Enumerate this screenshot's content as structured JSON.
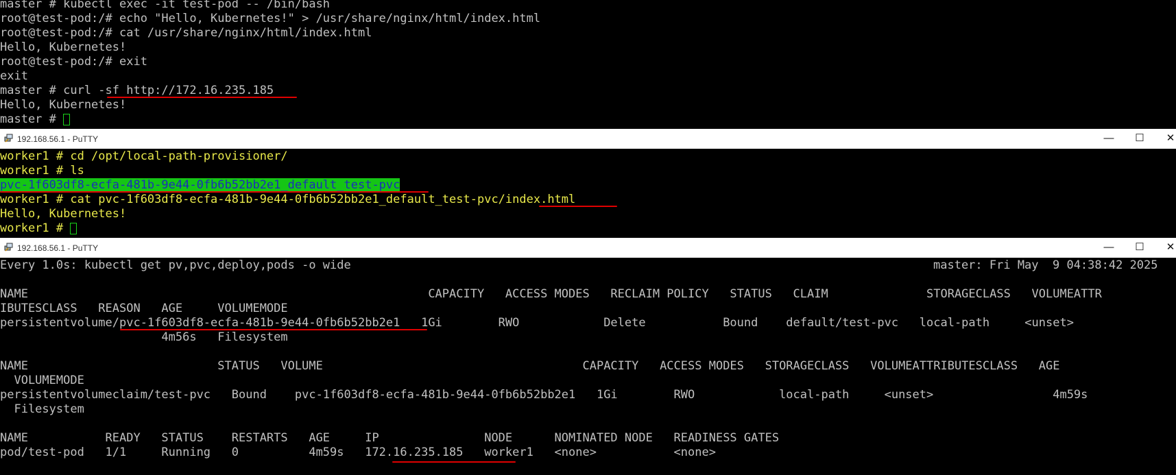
{
  "master_terminal": {
    "lines": [
      "master # kubectl exec -it test-pod -- /bin/bash",
      "root@test-pod:/# echo \"Hello, Kubernetes!\" > /usr/share/nginx/html/index.html",
      "root@test-pod:/# cat /usr/share/nginx/html/index.html",
      "Hello, Kubernetes!",
      "root@test-pod:/# exit",
      "exit",
      "master # curl -sf http://172.16.235.185",
      "Hello, Kubernetes!",
      "master # "
    ]
  },
  "worker_window": {
    "title": "192.168.56.1 - PuTTY",
    "minimize": "—",
    "maximize": "☐",
    "close": "✕",
    "lines": [
      "worker1 # cd /opt/local-path-provisioner/",
      "worker1 # ls",
      "pvc-1f603df8-ecfa-481b-9e44-0fb6b52bb2e1_default_test-pvc",
      "worker1 # cat pvc-1f603df8-ecfa-481b-9e44-0fb6b52bb2e1_default_test-pvc/index.html",
      "Hello, Kubernetes!",
      "worker1 # "
    ]
  },
  "watch_window": {
    "title": "192.168.56.1 - PuTTY",
    "minimize": "—",
    "maximize": "☐",
    "close": "✕",
    "header_left": "Every 1.0s: kubectl get pv,pvc,deploy,pods -o wide",
    "header_right": "master: Fri May  9 04:38:42 2025",
    "lines": [
      "NAME                                                         CAPACITY   ACCESS MODES   RECLAIM POLICY   STATUS   CLAIM              STORAGECLASS   VOLUMEATTR",
      "IBUTESCLASS   REASON   AGE     VOLUMEMODE",
      "persistentvolume/pvc-1f603df8-ecfa-481b-9e44-0fb6b52bb2e1   1Gi        RWO            Delete           Bound    default/test-pvc   local-path     <unset>",
      "                       4m56s   Filesystem",
      "",
      "NAME                           STATUS   VOLUME                                     CAPACITY   ACCESS MODES   STORAGECLASS   VOLUMEATTRIBUTESCLASS   AGE",
      "  VOLUMEMODE",
      "persistentvolumeclaim/test-pvc   Bound    pvc-1f603df8-ecfa-481b-9e44-0fb6b52bb2e1   1Gi        RWO            local-path     <unset>                 4m59s",
      "  Filesystem",
      "",
      "NAME           READY   STATUS    RESTARTS   AGE     IP               NODE      NOMINATED NODE   READINESS GATES",
      "pod/test-pod   1/1     Running   0          4m59s   172.16.235.185   worker1   <none>           <none>"
    ]
  }
}
